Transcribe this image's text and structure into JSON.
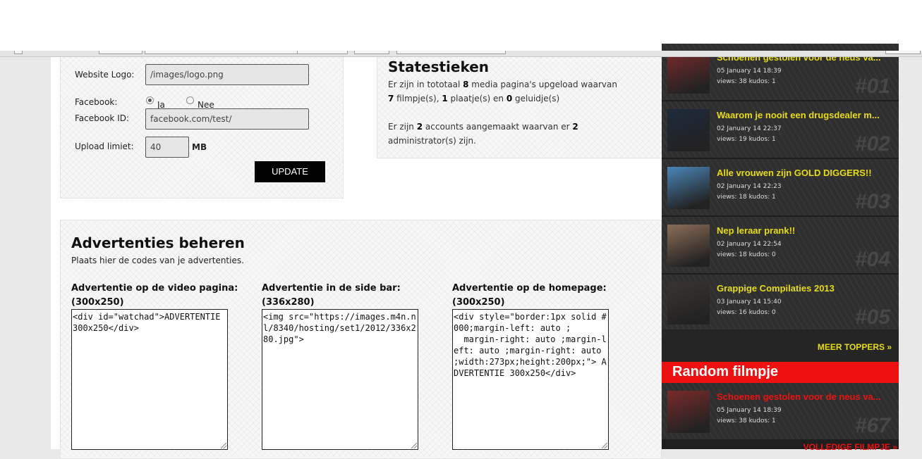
{
  "settings": {
    "website_logo_label": "Website Logo:",
    "website_logo_value": "/images/logo.png",
    "facebook_label": "Facebook:",
    "facebook_yes": "Ja",
    "facebook_no": "Nee",
    "facebook_selected": "Ja",
    "facebook_id_label": "Facebook ID:",
    "facebook_id_value": "facebook.com/test/",
    "upload_label": "Upload limiet:",
    "upload_value": "40",
    "upload_unit": "MB",
    "update_button": "UPDATE"
  },
  "stats": {
    "title": "Statestieken",
    "line1": [
      "Er zijn in tototaal ",
      "8",
      " media pagina's upgeload waarvan ",
      "7",
      " filmpje(s), ",
      "1",
      " plaatje(s) en ",
      "0",
      " geluidje(s)"
    ],
    "line2": [
      "Er zijn ",
      "2",
      " accounts aangemaakt waarvan er ",
      "2",
      " administrator(s) zijn."
    ]
  },
  "ads": {
    "title": "Advertenties beheren",
    "subtitle": "Plaats hier de codes van je advertenties.",
    "video": {
      "label": "Advertentie op de video pagina: (300x250)",
      "code": "<div id=\"watchad\">ADVERTENTIE 300x250</div>"
    },
    "sidebar": {
      "label": "Advertentie in de side bar: (336x280)",
      "code": "<img src=\"https://images.m4n.nl/8340/hosting/set1/2012/336x280.jpg\">"
    },
    "homepage": {
      "label": "Advertentie op de homepage: (300x250)",
      "code": "<div style=\"border:1px solid #000;margin-left: auto ;\n  margin-right: auto ;margin-left: auto ;margin-right: auto ;width:273px;height:200px;\"> ADVERTENTIE 300x250</div>"
    }
  },
  "toppers": [
    {
      "title": "Schoenen gestolen voor de neus va...",
      "date": "05 January 14 18:39",
      "stats": "views: 38   kudos: 1",
      "rank": "#01",
      "thumb_color": "#7a2a2a"
    },
    {
      "title": "Waarom je nooit een drugsdealer m...",
      "date": "02 January 14 22:37",
      "stats": "views: 19   kudos: 1",
      "rank": "#02",
      "thumb_color": "#1d2a3c"
    },
    {
      "title": "Alle vrouwen zijn GOLD DIGGERS!!",
      "date": "02 January 14 22:23",
      "stats": "views: 18   kudos: 1",
      "rank": "#03",
      "thumb_color": "#4a86b8"
    },
    {
      "title": "Nep leraar prank!!",
      "date": "02 January 14 22:54",
      "stats": "views: 18   kudos: 0",
      "rank": "#04",
      "thumb_color": "#8c6e58"
    },
    {
      "title": "Grappige Compilaties 2013",
      "date": "03 January 14 15:40",
      "stats": "views: 16   kudos: 0",
      "rank": "#05",
      "thumb_color": "#3a3430"
    }
  ],
  "meer_toppers": "MEER TOPPERS »",
  "random_title": "Random filmpje",
  "random_item": {
    "title": "Schoenen gestolen voor de neus va...",
    "date": "05 January 14 18:39",
    "stats": "views: 38   kudos: 1",
    "rank": "#67",
    "thumb_color": "#7a2a2a"
  },
  "volledige": "VOLLEDIGE FILMPJE »"
}
